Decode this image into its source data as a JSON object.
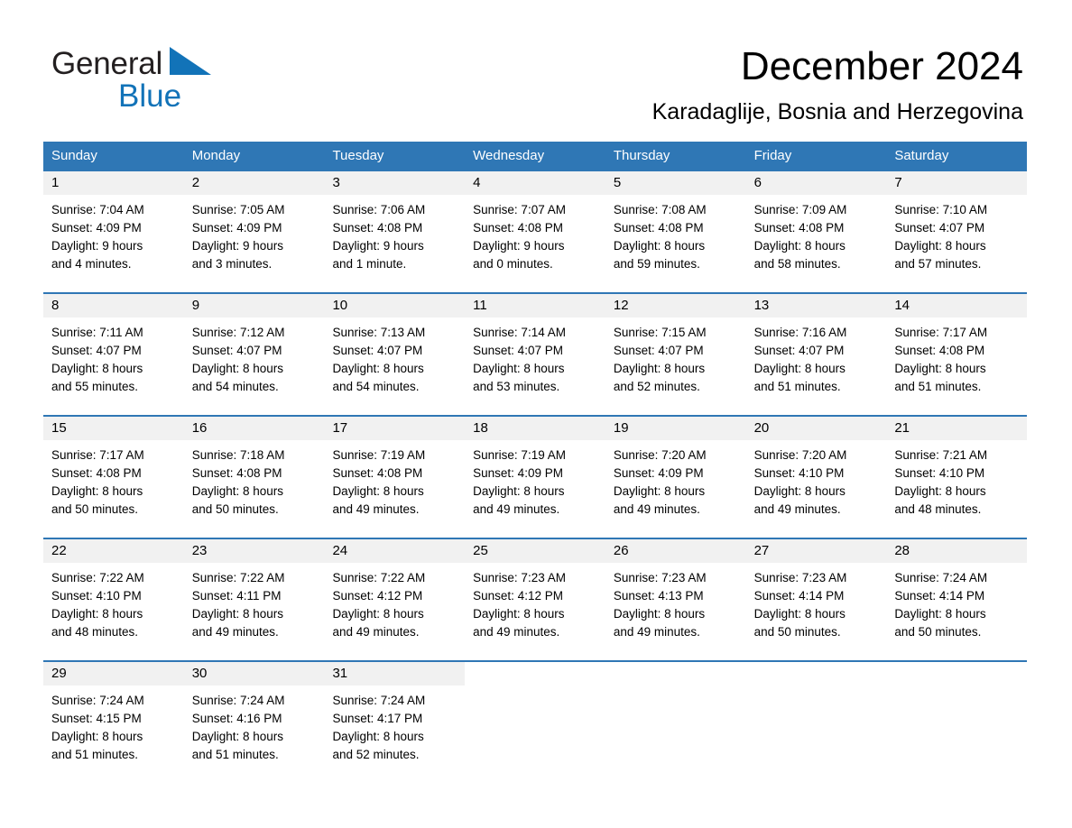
{
  "brand": {
    "name_part1": "General",
    "name_part2": "Blue",
    "logo_icon": "triangle-flag-icon",
    "accent_color": "#1273b8"
  },
  "header": {
    "title": "December 2024",
    "subtitle": "Karadaglije, Bosnia and Herzegovina"
  },
  "theme": {
    "header_blue": "#2f77b5",
    "daynum_band": "#f1f1f1",
    "text": "#000000"
  },
  "calendar": {
    "weekdays": [
      "Sunday",
      "Monday",
      "Tuesday",
      "Wednesday",
      "Thursday",
      "Friday",
      "Saturday"
    ],
    "weeks": [
      [
        {
          "day": "1",
          "sunrise": "Sunrise: 7:04 AM",
          "sunset": "Sunset: 4:09 PM",
          "daylight_line1": "Daylight: 9 hours",
          "daylight_line2": "and 4 minutes."
        },
        {
          "day": "2",
          "sunrise": "Sunrise: 7:05 AM",
          "sunset": "Sunset: 4:09 PM",
          "daylight_line1": "Daylight: 9 hours",
          "daylight_line2": "and 3 minutes."
        },
        {
          "day": "3",
          "sunrise": "Sunrise: 7:06 AM",
          "sunset": "Sunset: 4:08 PM",
          "daylight_line1": "Daylight: 9 hours",
          "daylight_line2": "and 1 minute."
        },
        {
          "day": "4",
          "sunrise": "Sunrise: 7:07 AM",
          "sunset": "Sunset: 4:08 PM",
          "daylight_line1": "Daylight: 9 hours",
          "daylight_line2": "and 0 minutes."
        },
        {
          "day": "5",
          "sunrise": "Sunrise: 7:08 AM",
          "sunset": "Sunset: 4:08 PM",
          "daylight_line1": "Daylight: 8 hours",
          "daylight_line2": "and 59 minutes."
        },
        {
          "day": "6",
          "sunrise": "Sunrise: 7:09 AM",
          "sunset": "Sunset: 4:08 PM",
          "daylight_line1": "Daylight: 8 hours",
          "daylight_line2": "and 58 minutes."
        },
        {
          "day": "7",
          "sunrise": "Sunrise: 7:10 AM",
          "sunset": "Sunset: 4:07 PM",
          "daylight_line1": "Daylight: 8 hours",
          "daylight_line2": "and 57 minutes."
        }
      ],
      [
        {
          "day": "8",
          "sunrise": "Sunrise: 7:11 AM",
          "sunset": "Sunset: 4:07 PM",
          "daylight_line1": "Daylight: 8 hours",
          "daylight_line2": "and 55 minutes."
        },
        {
          "day": "9",
          "sunrise": "Sunrise: 7:12 AM",
          "sunset": "Sunset: 4:07 PM",
          "daylight_line1": "Daylight: 8 hours",
          "daylight_line2": "and 54 minutes."
        },
        {
          "day": "10",
          "sunrise": "Sunrise: 7:13 AM",
          "sunset": "Sunset: 4:07 PM",
          "daylight_line1": "Daylight: 8 hours",
          "daylight_line2": "and 54 minutes."
        },
        {
          "day": "11",
          "sunrise": "Sunrise: 7:14 AM",
          "sunset": "Sunset: 4:07 PM",
          "daylight_line1": "Daylight: 8 hours",
          "daylight_line2": "and 53 minutes."
        },
        {
          "day": "12",
          "sunrise": "Sunrise: 7:15 AM",
          "sunset": "Sunset: 4:07 PM",
          "daylight_line1": "Daylight: 8 hours",
          "daylight_line2": "and 52 minutes."
        },
        {
          "day": "13",
          "sunrise": "Sunrise: 7:16 AM",
          "sunset": "Sunset: 4:07 PM",
          "daylight_line1": "Daylight: 8 hours",
          "daylight_line2": "and 51 minutes."
        },
        {
          "day": "14",
          "sunrise": "Sunrise: 7:17 AM",
          "sunset": "Sunset: 4:08 PM",
          "daylight_line1": "Daylight: 8 hours",
          "daylight_line2": "and 51 minutes."
        }
      ],
      [
        {
          "day": "15",
          "sunrise": "Sunrise: 7:17 AM",
          "sunset": "Sunset: 4:08 PM",
          "daylight_line1": "Daylight: 8 hours",
          "daylight_line2": "and 50 minutes."
        },
        {
          "day": "16",
          "sunrise": "Sunrise: 7:18 AM",
          "sunset": "Sunset: 4:08 PM",
          "daylight_line1": "Daylight: 8 hours",
          "daylight_line2": "and 50 minutes."
        },
        {
          "day": "17",
          "sunrise": "Sunrise: 7:19 AM",
          "sunset": "Sunset: 4:08 PM",
          "daylight_line1": "Daylight: 8 hours",
          "daylight_line2": "and 49 minutes."
        },
        {
          "day": "18",
          "sunrise": "Sunrise: 7:19 AM",
          "sunset": "Sunset: 4:09 PM",
          "daylight_line1": "Daylight: 8 hours",
          "daylight_line2": "and 49 minutes."
        },
        {
          "day": "19",
          "sunrise": "Sunrise: 7:20 AM",
          "sunset": "Sunset: 4:09 PM",
          "daylight_line1": "Daylight: 8 hours",
          "daylight_line2": "and 49 minutes."
        },
        {
          "day": "20",
          "sunrise": "Sunrise: 7:20 AM",
          "sunset": "Sunset: 4:10 PM",
          "daylight_line1": "Daylight: 8 hours",
          "daylight_line2": "and 49 minutes."
        },
        {
          "day": "21",
          "sunrise": "Sunrise: 7:21 AM",
          "sunset": "Sunset: 4:10 PM",
          "daylight_line1": "Daylight: 8 hours",
          "daylight_line2": "and 48 minutes."
        }
      ],
      [
        {
          "day": "22",
          "sunrise": "Sunrise: 7:22 AM",
          "sunset": "Sunset: 4:10 PM",
          "daylight_line1": "Daylight: 8 hours",
          "daylight_line2": "and 48 minutes."
        },
        {
          "day": "23",
          "sunrise": "Sunrise: 7:22 AM",
          "sunset": "Sunset: 4:11 PM",
          "daylight_line1": "Daylight: 8 hours",
          "daylight_line2": "and 49 minutes."
        },
        {
          "day": "24",
          "sunrise": "Sunrise: 7:22 AM",
          "sunset": "Sunset: 4:12 PM",
          "daylight_line1": "Daylight: 8 hours",
          "daylight_line2": "and 49 minutes."
        },
        {
          "day": "25",
          "sunrise": "Sunrise: 7:23 AM",
          "sunset": "Sunset: 4:12 PM",
          "daylight_line1": "Daylight: 8 hours",
          "daylight_line2": "and 49 minutes."
        },
        {
          "day": "26",
          "sunrise": "Sunrise: 7:23 AM",
          "sunset": "Sunset: 4:13 PM",
          "daylight_line1": "Daylight: 8 hours",
          "daylight_line2": "and 49 minutes."
        },
        {
          "day": "27",
          "sunrise": "Sunrise: 7:23 AM",
          "sunset": "Sunset: 4:14 PM",
          "daylight_line1": "Daylight: 8 hours",
          "daylight_line2": "and 50 minutes."
        },
        {
          "day": "28",
          "sunrise": "Sunrise: 7:24 AM",
          "sunset": "Sunset: 4:14 PM",
          "daylight_line1": "Daylight: 8 hours",
          "daylight_line2": "and 50 minutes."
        }
      ],
      [
        {
          "day": "29",
          "sunrise": "Sunrise: 7:24 AM",
          "sunset": "Sunset: 4:15 PM",
          "daylight_line1": "Daylight: 8 hours",
          "daylight_line2": "and 51 minutes."
        },
        {
          "day": "30",
          "sunrise": "Sunrise: 7:24 AM",
          "sunset": "Sunset: 4:16 PM",
          "daylight_line1": "Daylight: 8 hours",
          "daylight_line2": "and 51 minutes."
        },
        {
          "day": "31",
          "sunrise": "Sunrise: 7:24 AM",
          "sunset": "Sunset: 4:17 PM",
          "daylight_line1": "Daylight: 8 hours",
          "daylight_line2": "and 52 minutes."
        },
        {
          "day": "",
          "sunrise": "",
          "sunset": "",
          "daylight_line1": "",
          "daylight_line2": ""
        },
        {
          "day": "",
          "sunrise": "",
          "sunset": "",
          "daylight_line1": "",
          "daylight_line2": ""
        },
        {
          "day": "",
          "sunrise": "",
          "sunset": "",
          "daylight_line1": "",
          "daylight_line2": ""
        },
        {
          "day": "",
          "sunrise": "",
          "sunset": "",
          "daylight_line1": "",
          "daylight_line2": ""
        }
      ]
    ]
  }
}
